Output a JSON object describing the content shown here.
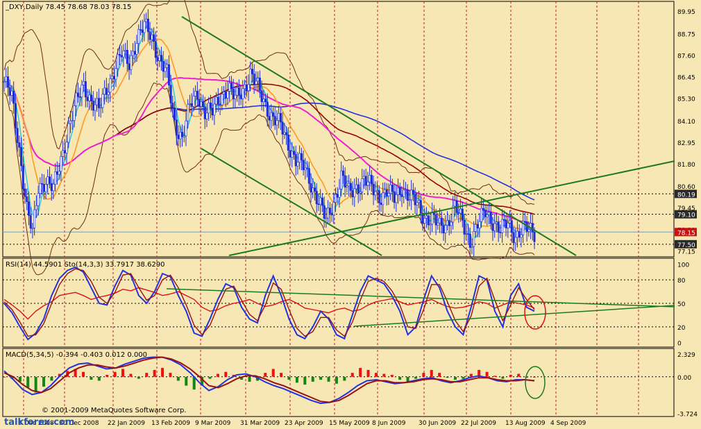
{
  "chart_data": [
    {
      "type": "candlestick",
      "symbol_header": "_DXY,Daily  78.45 78.68 78.03 78.15",
      "price_ticks": [
        "89.95",
        "88.75",
        "87.60",
        "86.45",
        "85.30",
        "84.10",
        "82.95",
        "81.80",
        "80.60",
        "79.45",
        "78.30",
        "77.15"
      ],
      "price_tick_values": [
        89.95,
        88.75,
        87.6,
        86.45,
        85.3,
        84.1,
        82.95,
        81.8,
        80.6,
        79.45,
        78.3,
        77.15
      ],
      "ylim": [
        76.9,
        90.4
      ],
      "level_markers": [
        {
          "label": "80.19",
          "value": 80.19,
          "bg": "#2A2A2A",
          "fg": "#FFFFFF"
        },
        {
          "label": "79.10",
          "value": 79.1,
          "bg": "#2A2A2A",
          "fg": "#FFFFFF"
        },
        {
          "label": "78.15",
          "value": 78.15,
          "bg": "#CC1111",
          "fg": "#FFFFFF"
        },
        {
          "label": "77.50",
          "value": 77.5,
          "bg": "#2A2A2A",
          "fg": "#FFFFFF"
        }
      ],
      "dashed_levels": [
        80.19,
        79.1,
        77.5
      ],
      "current_price": 78.15,
      "x_labels": [
        "9 Dec 2008",
        "30 Dec 2008",
        "22 Jan 2009",
        "13 Feb 2009",
        "9 Mar 2009",
        "31 Mar 2009",
        "23 Apr 2009",
        "15 May 2009",
        "8 Jun 2009",
        "30 Jun 2009",
        "22 Jul 2009",
        "13 Aug 2009",
        "4 Sep 2009"
      ],
      "close_series": [
        {
          "i": 0,
          "v": 86.2
        },
        {
          "i": 4,
          "v": 85.3
        },
        {
          "i": 8,
          "v": 82.6
        },
        {
          "i": 12,
          "v": 79.4
        },
        {
          "i": 15,
          "v": 78.0
        },
        {
          "i": 18,
          "v": 80.5
        },
        {
          "i": 22,
          "v": 81.0
        },
        {
          "i": 26,
          "v": 80.4
        },
        {
          "i": 30,
          "v": 82.0
        },
        {
          "i": 34,
          "v": 83.8
        },
        {
          "i": 38,
          "v": 85.0
        },
        {
          "i": 42,
          "v": 86.0
        },
        {
          "i": 46,
          "v": 85.2
        },
        {
          "i": 50,
          "v": 84.6
        },
        {
          "i": 54,
          "v": 85.8
        },
        {
          "i": 58,
          "v": 86.8
        },
        {
          "i": 62,
          "v": 87.6
        },
        {
          "i": 66,
          "v": 87.2
        },
        {
          "i": 70,
          "v": 88.5
        },
        {
          "i": 74,
          "v": 89.1
        },
        {
          "i": 78,
          "v": 88.6
        },
        {
          "i": 82,
          "v": 87.4
        },
        {
          "i": 86,
          "v": 86.5
        },
        {
          "i": 90,
          "v": 84.0
        },
        {
          "i": 94,
          "v": 83.2
        },
        {
          "i": 98,
          "v": 84.8
        },
        {
          "i": 102,
          "v": 85.6
        },
        {
          "i": 106,
          "v": 84.6
        },
        {
          "i": 110,
          "v": 84.5
        },
        {
          "i": 114,
          "v": 85.4
        },
        {
          "i": 118,
          "v": 85.9
        },
        {
          "i": 122,
          "v": 85.2
        },
        {
          "i": 126,
          "v": 85.8
        },
        {
          "i": 130,
          "v": 86.6
        },
        {
          "i": 134,
          "v": 85.8
        },
        {
          "i": 138,
          "v": 85.0
        },
        {
          "i": 142,
          "v": 84.2
        },
        {
          "i": 146,
          "v": 83.8
        },
        {
          "i": 150,
          "v": 82.9
        },
        {
          "i": 154,
          "v": 82.0
        },
        {
          "i": 158,
          "v": 81.6
        },
        {
          "i": 162,
          "v": 80.8
        },
        {
          "i": 166,
          "v": 79.8
        },
        {
          "i": 170,
          "v": 78.7
        },
        {
          "i": 174,
          "v": 79.8
        },
        {
          "i": 178,
          "v": 81.1
        },
        {
          "i": 182,
          "v": 80.2
        },
        {
          "i": 186,
          "v": 80.6
        },
        {
          "i": 190,
          "v": 80.9
        },
        {
          "i": 194,
          "v": 80.5
        },
        {
          "i": 198,
          "v": 80.1
        },
        {
          "i": 202,
          "v": 80.3
        },
        {
          "i": 206,
          "v": 79.9
        },
        {
          "i": 210,
          "v": 80.6
        },
        {
          "i": 214,
          "v": 80.0
        },
        {
          "i": 218,
          "v": 79.6
        },
        {
          "i": 222,
          "v": 79.0
        },
        {
          "i": 226,
          "v": 78.8
        },
        {
          "i": 230,
          "v": 78.4
        },
        {
          "i": 234,
          "v": 78.7
        },
        {
          "i": 238,
          "v": 79.5
        },
        {
          "i": 242,
          "v": 78.6
        },
        {
          "i": 246,
          "v": 77.7
        },
        {
          "i": 250,
          "v": 78.5
        },
        {
          "i": 254,
          "v": 79.2
        },
        {
          "i": 258,
          "v": 78.8
        },
        {
          "i": 262,
          "v": 78.2
        },
        {
          "i": 266,
          "v": 78.6
        },
        {
          "i": 270,
          "v": 78.0
        },
        {
          "i": 274,
          "v": 78.3
        },
        {
          "i": 278,
          "v": 78.2
        },
        {
          "i": 280,
          "v": 78.15
        }
      ],
      "ma_series": [
        {
          "name": "",
          "color": "#33CCDD",
          "period": "fast"
        },
        {
          "name": "",
          "color": "#FF9922",
          "period": "medium"
        },
        {
          "name": "",
          "color": "#EE22CC",
          "period": "long"
        },
        {
          "name": "",
          "color": "#990000",
          "period": "longer"
        },
        {
          "name": "",
          "color": "#2233DD",
          "period": "longest"
        }
      ],
      "grid": "dashed"
    },
    {
      "type": "line",
      "header": "RSI(14) 44.5901  Sto(14,3,3) 33.7917 38.6290",
      "y_ticks": [
        "100",
        "80",
        "50",
        "20",
        "0"
      ],
      "y_tick_values": [
        100,
        80,
        50,
        20,
        0
      ],
      "ylim": [
        -4,
        104
      ],
      "series": [
        {
          "name": "",
          "color": "#DD1111",
          "values": [
            55,
            48,
            40,
            30,
            40,
            47,
            52,
            60,
            62,
            64,
            60,
            55,
            58,
            60,
            63,
            68,
            66,
            70,
            67,
            64,
            60,
            62,
            65,
            60,
            55,
            45,
            40,
            42,
            47,
            50,
            52,
            55,
            50,
            46,
            48,
            52,
            55,
            50,
            44,
            42,
            40,
            38,
            42,
            44,
            40,
            42,
            48,
            52,
            54,
            56,
            52,
            48,
            50,
            52,
            55,
            50,
            46,
            44,
            45,
            48,
            52,
            50,
            44,
            48,
            52,
            50,
            48,
            44
          ]
        },
        {
          "name": "",
          "color": "#2233DD",
          "values": [
            50,
            38,
            20,
            4,
            12,
            30,
            60,
            82,
            92,
            96,
            90,
            70,
            50,
            48,
            72,
            92,
            86,
            60,
            50,
            65,
            88,
            84,
            60,
            40,
            12,
            8,
            30,
            55,
            75,
            70,
            45,
            30,
            25,
            60,
            85,
            60,
            30,
            10,
            5,
            20,
            40,
            30,
            10,
            5,
            35,
            65,
            85,
            80,
            75,
            60,
            40,
            10,
            20,
            55,
            85,
            70,
            40,
            20,
            10,
            45,
            85,
            80,
            40,
            20,
            60,
            75,
            45,
            40
          ]
        },
        {
          "name": "",
          "color": "#991111",
          "values": [
            52,
            42,
            26,
            8,
            10,
            24,
            50,
            74,
            88,
            94,
            92,
            78,
            58,
            50,
            64,
            86,
            88,
            70,
            54,
            60,
            80,
            86,
            70,
            48,
            22,
            10,
            22,
            46,
            68,
            72,
            54,
            36,
            28,
            48,
            76,
            68,
            42,
            18,
            8,
            14,
            32,
            32,
            16,
            8,
            26,
            54,
            78,
            82,
            78,
            66,
            48,
            20,
            18,
            42,
            74,
            74,
            52,
            28,
            14,
            34,
            72,
            82,
            54,
            28,
            48,
            70,
            55,
            42
          ]
        }
      ],
      "level_lines": [
        80,
        50,
        20
      ]
    },
    {
      "type": "bar",
      "header": "MACD(5,34,5) -0.394 -0.403 0.012 0.000",
      "y_ticks": [
        "2.329",
        "0.00",
        "-3.724"
      ],
      "y_tick_values": [
        2.329,
        0.0,
        -3.724
      ],
      "ylim": [
        -3.9,
        2.6
      ],
      "histogram": [
        0.0,
        -0.2,
        -0.5,
        -1.1,
        -1.6,
        -1.0,
        -0.4,
        0.3,
        0.6,
        0.8,
        0.5,
        -0.3,
        -0.4,
        0.2,
        0.5,
        0.8,
        0.3,
        -0.2,
        0.4,
        0.7,
        0.9,
        0.4,
        -0.4,
        -0.9,
        -1.3,
        -0.9,
        -0.2,
        0.3,
        0.5,
        0.2,
        -0.3,
        -0.5,
        -0.4,
        0.4,
        0.8,
        0.4,
        -0.3,
        -0.6,
        -0.8,
        -0.5,
        -0.3,
        -0.5,
        -0.7,
        -0.4,
        0.4,
        0.9,
        0.7,
        0.4,
        0.3,
        0.2,
        -0.3,
        -0.6,
        -0.2,
        0.4,
        0.7,
        0.4,
        -0.1,
        -0.3,
        -0.2,
        0.3,
        0.7,
        0.5,
        0.1,
        -0.2,
        0.2,
        0.3,
        -0.1,
        0.0
      ],
      "series": [
        {
          "name": "",
          "color": "#2233DD",
          "values": [
            0.6,
            -0.3,
            -1.3,
            -1.8,
            -1.6,
            -0.9,
            0.1,
            0.9,
            1.3,
            1.4,
            1.1,
            0.8,
            0.9,
            1.3,
            1.6,
            1.9,
            2.0,
            2.0,
            1.7,
            1.2,
            0.4,
            -0.6,
            -1.4,
            -1.0,
            -0.3,
            0.2,
            0.3,
            0.0,
            -0.5,
            -0.9,
            -1.2,
            -1.6,
            -2.0,
            -2.4,
            -2.7,
            -2.6,
            -2.2,
            -1.6,
            -0.9,
            -0.4,
            -0.3,
            -0.5,
            -0.7,
            -0.6,
            -0.4,
            -0.2,
            -0.1,
            -0.4,
            -0.6,
            -0.4,
            -0.1,
            0.1,
            -0.1,
            -0.4,
            -0.5,
            -0.3,
            -0.3,
            -0.4
          ]
        },
        {
          "name": "",
          "color": "#991111",
          "values": [
            0.4,
            0.0,
            -0.8,
            -1.4,
            -1.6,
            -1.2,
            -0.4,
            0.4,
            0.9,
            1.2,
            1.2,
            1.0,
            0.9,
            1.1,
            1.4,
            1.7,
            1.9,
            2.0,
            1.8,
            1.4,
            0.8,
            0.0,
            -0.9,
            -1.1,
            -0.7,
            -0.2,
            0.1,
            0.1,
            -0.2,
            -0.6,
            -0.9,
            -1.3,
            -1.7,
            -2.1,
            -2.5,
            -2.6,
            -2.4,
            -1.9,
            -1.3,
            -0.7,
            -0.4,
            -0.4,
            -0.6,
            -0.6,
            -0.5,
            -0.3,
            -0.2,
            -0.3,
            -0.5,
            -0.5,
            -0.3,
            -0.1,
            -0.1,
            -0.3,
            -0.4,
            -0.4,
            -0.3,
            -0.4
          ]
        }
      ]
    }
  ],
  "watermark": {
    "copyright": "© 2001-2009 MetaQuotes Software Corp.",
    "site": "talkforex.com"
  }
}
